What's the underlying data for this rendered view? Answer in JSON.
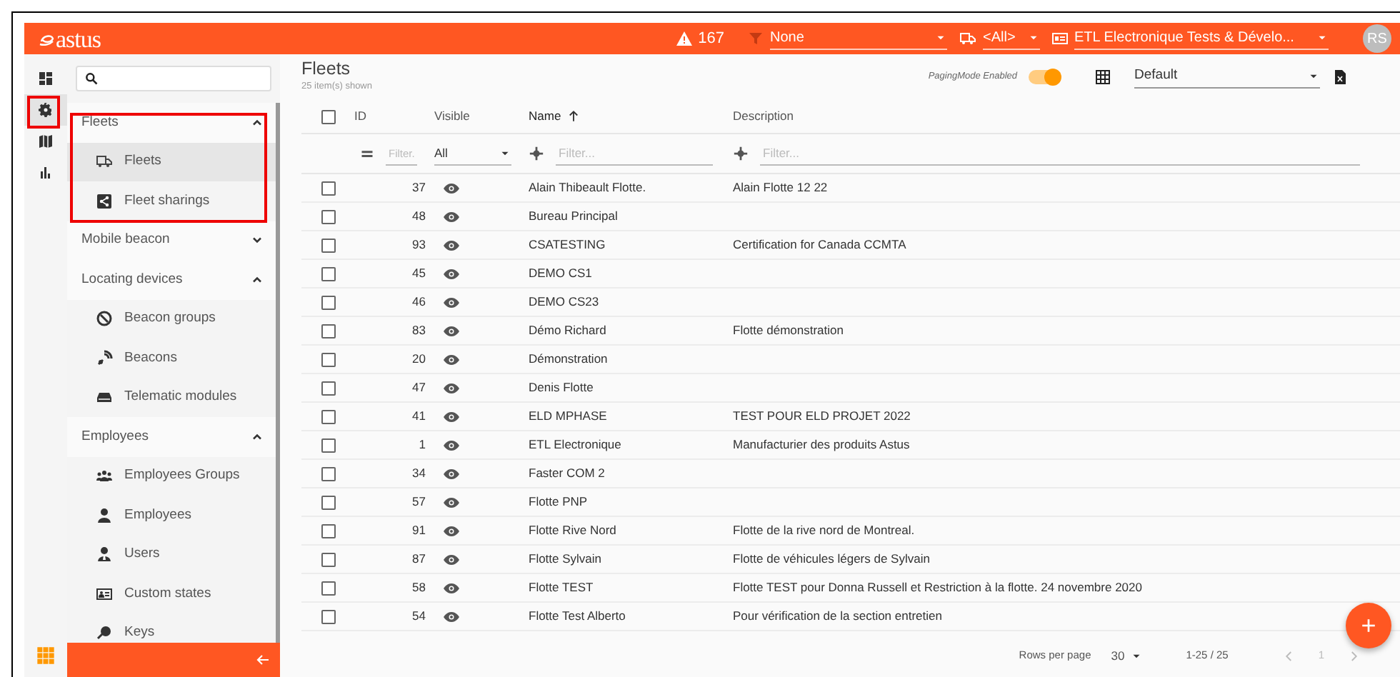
{
  "topbar": {
    "logo": "astus",
    "alerts": "167",
    "filter": {
      "value": "None"
    },
    "vehicle_filter": {
      "value": "<All>"
    },
    "company": {
      "value": "ETL Electronique Tests & Dévelo..."
    },
    "avatar": "RS"
  },
  "rail": [
    {
      "selected": false
    },
    {
      "selected": true
    },
    {
      "selected": false
    },
    {
      "selected": false
    }
  ],
  "sidebar": {
    "groups": [
      {
        "label": "Fleets",
        "expanded": true,
        "children": [
          {
            "label": "Fleets",
            "selected": true
          },
          {
            "label": "Fleet sharings",
            "selected": false
          }
        ]
      },
      {
        "label": "Mobile beacon",
        "expanded": false
      },
      {
        "label": "Locating devices",
        "expanded": true,
        "children": [
          {
            "label": "Beacon groups",
            "selected": false
          },
          {
            "label": "Beacons",
            "selected": false
          },
          {
            "label": "Telematic modules",
            "selected": false
          }
        ]
      },
      {
        "label": "Employees",
        "expanded": true,
        "children": [
          {
            "label": "Employees Groups",
            "selected": false
          },
          {
            "label": "Employees",
            "selected": false
          },
          {
            "label": "Users",
            "selected": false
          },
          {
            "label": "Custom states",
            "selected": false
          },
          {
            "label": "Keys",
            "selected": false
          }
        ]
      }
    ]
  },
  "page": {
    "title": "Fleets",
    "subtitle": "25 item(s) shown",
    "paging_label": "PagingMode Enabled",
    "paging_on": true,
    "view": {
      "value": "Default"
    }
  },
  "add_button": "+",
  "table": {
    "select_all_checked": false,
    "columns": [
      {
        "label": "ID",
        "sorted": false
      },
      {
        "label": "Visible",
        "sorted": false
      },
      {
        "label": "Name",
        "sorted": true
      },
      {
        "label": "Description",
        "sorted": false
      }
    ],
    "filters": {
      "id": {
        "placeholder": "Filter."
      },
      "visible": {
        "value": "All"
      },
      "name": {
        "placeholder": "Filter..."
      },
      "description": {
        "placeholder": "Filter..."
      }
    },
    "rows": [
      {
        "id": "37",
        "visible": true,
        "name": "Alain Thibeault Flotte.",
        "description": "Alain Flotte 12 22",
        "checked": false
      },
      {
        "id": "48",
        "visible": true,
        "name": "Bureau Principal",
        "checked": false
      },
      {
        "id": "93",
        "visible": true,
        "name": "CSATESTING",
        "description": "Certification for Canada CCMTA",
        "checked": false
      },
      {
        "id": "45",
        "visible": true,
        "name": "DEMO CS1",
        "checked": false
      },
      {
        "id": "46",
        "visible": true,
        "name": "DEMO CS23",
        "checked": false
      },
      {
        "id": "83",
        "visible": true,
        "name": "Démo Richard",
        "description": "Flotte démonstration",
        "checked": false
      },
      {
        "id": "20",
        "visible": true,
        "name": "Démonstration",
        "checked": false
      },
      {
        "id": "47",
        "visible": true,
        "name": "Denis Flotte",
        "checked": false
      },
      {
        "id": "41",
        "visible": true,
        "name": "ELD MPHASE",
        "description": "TEST POUR ELD PROJET 2022",
        "checked": false
      },
      {
        "id": "1",
        "visible": true,
        "name": "ETL Electronique",
        "description": "Manufacturier des produits Astus",
        "checked": false
      },
      {
        "id": "34",
        "visible": true,
        "name": "Faster COM 2",
        "checked": false
      },
      {
        "id": "57",
        "visible": true,
        "name": "Flotte PNP",
        "checked": false
      },
      {
        "id": "91",
        "visible": true,
        "name": "Flotte Rive Nord",
        "description": "Flotte de la rive nord de Montreal.",
        "checked": false
      },
      {
        "id": "87",
        "visible": true,
        "name": "Flotte Sylvain",
        "description": "Flotte de véhicules légers de Sylvain",
        "checked": false
      },
      {
        "id": "58",
        "visible": true,
        "name": "Flotte TEST",
        "description": "Flotte TEST pour Donna Russell et Restriction à la flotte. 24 novembre 2020",
        "checked": false
      },
      {
        "id": "54",
        "visible": true,
        "name": "Flotte Test Alberto",
        "description": "Pour vérification de la section entretien",
        "checked": false
      }
    ]
  },
  "pagination": {
    "rows_label": "Rows per page",
    "rows_value": "30",
    "range": "1-25 / 25",
    "page": "1"
  }
}
